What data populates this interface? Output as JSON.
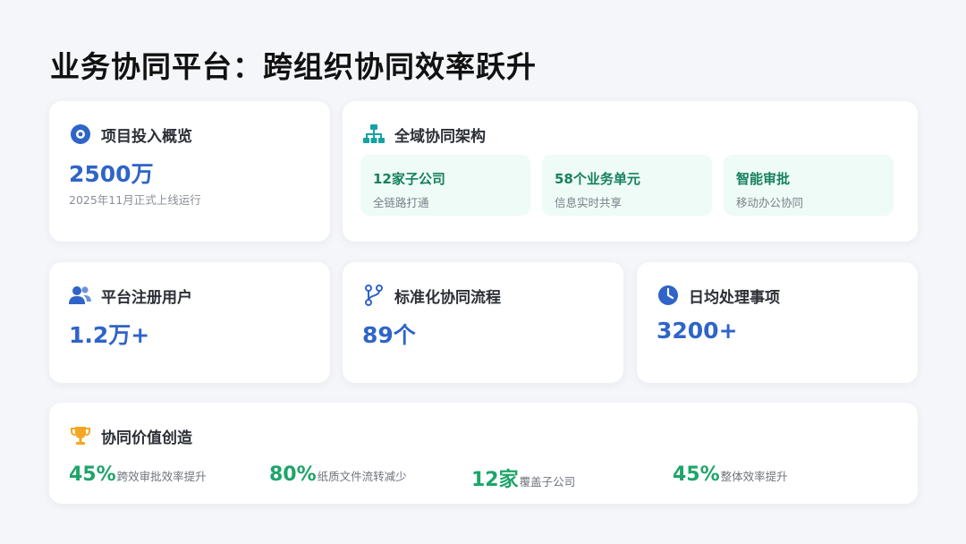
{
  "title": "业务协同平台：跨组织协同效率跃升",
  "overview": {
    "label": "项目投入概览",
    "value": "2500万",
    "note": "2025年11月正式上线运行"
  },
  "architecture": {
    "label": "全域协同架构",
    "tiles": [
      {
        "title": "12家子公司",
        "desc": "全链路打通"
      },
      {
        "title": "58个业务单元",
        "desc": "信息实时共享"
      },
      {
        "title": "智能审批",
        "desc": "移动办公协同"
      }
    ]
  },
  "metrics": [
    {
      "label": "平台注册用户",
      "value": "1.2万+",
      "icon": "users-icon"
    },
    {
      "label": "标准化协同流程",
      "value": "89个",
      "icon": "branch-icon"
    },
    {
      "label": "日均处理事项",
      "value": "3200+",
      "icon": "clock-icon"
    }
  ],
  "value_creation": {
    "label": "协同价值创造",
    "icon": "trophy-icon",
    "stats": [
      {
        "value": "45%",
        "desc": "跨效审批效率提升"
      },
      {
        "value": "80%",
        "desc": "纸质文件流转减少"
      },
      {
        "value": "12家",
        "desc": "覆盖子公司"
      },
      {
        "value": "45%",
        "desc": "整体效率提升"
      }
    ]
  },
  "colors": {
    "accent_blue": "#2f64c8",
    "accent_green": "#1fa46a",
    "tile_bg": "#eefbf6",
    "trophy": "#f5a623"
  }
}
